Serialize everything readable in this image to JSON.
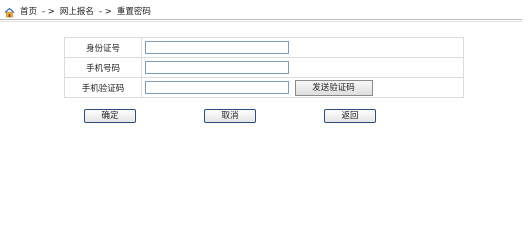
{
  "breadcrumb": {
    "items": [
      "首页",
      "网上报名",
      "重置密码"
    ],
    "separator": "- >"
  },
  "form": {
    "id_label": "身份证号",
    "id_value": "",
    "phone_label": "手机号码",
    "phone_value": "",
    "code_label": "手机验证码",
    "code_value": "",
    "send_code_label": "发送验证码"
  },
  "actions": {
    "confirm_label": "确定",
    "cancel_label": "取消",
    "back_label": "返回"
  },
  "icons": {
    "home": "home-icon"
  }
}
